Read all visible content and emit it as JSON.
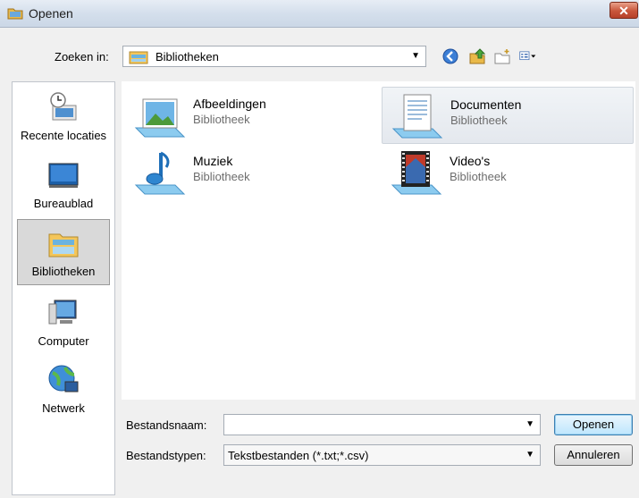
{
  "window": {
    "title": "Openen",
    "close_glyph": "✕"
  },
  "toolbar": {
    "lookin_label": "Zoeken in:",
    "lookin_value": "Bibliotheken",
    "icons": [
      "back-icon",
      "up-folder-icon",
      "new-folder-icon",
      "view-menu-icon"
    ]
  },
  "places": [
    {
      "label": "Recente locaties",
      "icon": "recent-locations-icon"
    },
    {
      "label": "Bureaublad",
      "icon": "desktop-icon"
    },
    {
      "label": "Bibliotheken",
      "icon": "libraries-icon",
      "selected": true
    },
    {
      "label": "Computer",
      "icon": "computer-icon"
    },
    {
      "label": "Netwerk",
      "icon": "network-icon"
    }
  ],
  "items": [
    {
      "name": "Afbeeldingen",
      "sub": "Bibliotheek",
      "icon": "pictures-library-icon"
    },
    {
      "name": "Documenten",
      "sub": "Bibliotheek",
      "icon": "documents-library-icon",
      "highlighted": true
    },
    {
      "name": "Muziek",
      "sub": "Bibliotheek",
      "icon": "music-library-icon"
    },
    {
      "name": "Video's",
      "sub": "Bibliotheek",
      "icon": "videos-library-icon"
    }
  ],
  "form": {
    "filename_label": "Bestandsnaam:",
    "filename_value": "",
    "filetype_label": "Bestandstypen:",
    "filetype_value": "Tekstbestanden (*.txt;*.csv)",
    "open_label": "Openen",
    "cancel_label": "Annuleren"
  },
  "colors": {
    "accent": "#3c7fb1",
    "close": "#c8553a",
    "selection": "#d9d9d9"
  }
}
